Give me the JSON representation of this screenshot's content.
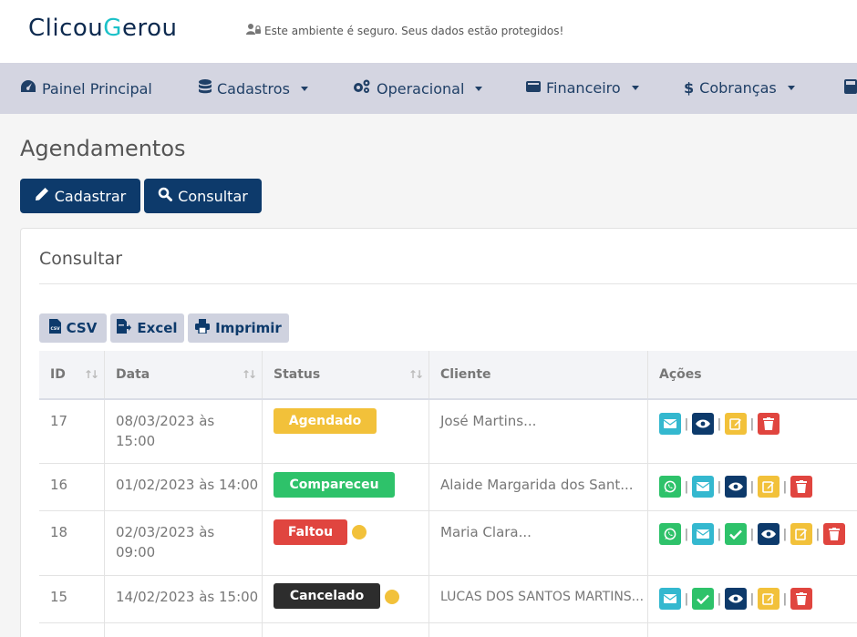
{
  "header": {
    "logo_prefix": "Clicou",
    "logo_accent": "G",
    "logo_suffix": "erou",
    "secure_text": "Este ambiente é seguro. Seus dados estão protegidos!"
  },
  "nav": {
    "items": [
      {
        "label": "Painel Principal",
        "icon": "dashboard-icon"
      },
      {
        "label": "Cadastros",
        "icon": "database-icon"
      },
      {
        "label": "Operacional",
        "icon": "gears-icon"
      },
      {
        "label": "Financeiro",
        "icon": "wallet-icon"
      },
      {
        "label": "Cobranças",
        "icon": "dollar-icon"
      }
    ]
  },
  "page": {
    "title": "Agendamentos",
    "btn_cadastrar": "Cadastrar",
    "btn_consultar": "Consultar"
  },
  "card": {
    "title": "Consultar",
    "export": {
      "csv": "CSV",
      "excel": "Excel",
      "print": "Imprimir"
    }
  },
  "table": {
    "headers": {
      "id": "ID",
      "data": "Data",
      "status": "Status",
      "cliente": "Cliente",
      "acoes": "Ações"
    },
    "rows": [
      {
        "id": "17",
        "data_line1": "08/03/2023 às",
        "data_line2": "15:00",
        "status": "Agendado",
        "cliente": "José Martins..."
      },
      {
        "id": "16",
        "data_line1": "01/02/2023 às 14:00",
        "data_line2": "",
        "status": "Compareceu",
        "cliente": "Alaide Margarida dos Sant..."
      },
      {
        "id": "18",
        "data_line1": "02/03/2023 às",
        "data_line2": "09:00",
        "status": "Faltou",
        "cliente": "Maria Clara..."
      },
      {
        "id": "15",
        "data_line1": "14/02/2023 às 15:00",
        "data_line2": "",
        "status": "Cancelado",
        "cliente": "LUCAS DOS SANTOS MARTINS..."
      }
    ]
  },
  "colors": {
    "brand_navy": "#0d3a6b",
    "accent": "#1bc1c8",
    "status_agendado": "#f2c13a",
    "status_compareceu": "#2ec26a",
    "status_faltou": "#e0453f",
    "status_cancelado": "#2d2d2d"
  }
}
